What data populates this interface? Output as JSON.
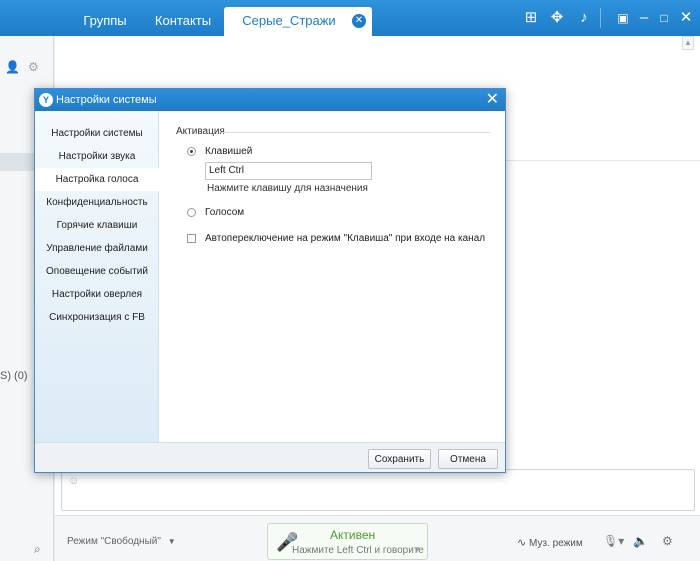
{
  "tabs": [
    {
      "label": "Группы"
    },
    {
      "label": "Контакты"
    },
    {
      "label": "Серые_Стражи",
      "active": true
    }
  ],
  "top_icons": [
    "gift-icon",
    "gamepad-icon",
    "bell-icon",
    "window-menu-icon",
    "minimize-icon",
    "maximize-icon",
    "close-icon"
  ],
  "left_panel": {
    "count_text": "S) (0)"
  },
  "dialog": {
    "title": "Настройки системы",
    "nav": [
      "Настройки системы",
      "Настройки звука",
      "Настройка голоса",
      "Конфиденциальность",
      "Горячие клавиши",
      "Управление файлами",
      "Оповещение событий",
      "Настройки оверлея",
      "Синхронизация с FB"
    ],
    "active_nav_index": 2,
    "group_label": "Активация",
    "option_key": "Клавишей",
    "key_value": "Left Ctrl",
    "key_hint": "Нажмите клавишу для назначения",
    "option_voice": "Голосом",
    "auto_switch": "Автопереключение на режим \"Клавиша\" при входе на канал",
    "save_label": "Сохранить",
    "cancel_label": "Отмена"
  },
  "bottom": {
    "mode": "Режим \"Свободный\"",
    "voice_status": "Активен",
    "voice_hint": "Нажмите Left Ctrl и говорите",
    "music_mode": "Муз. режим"
  },
  "colors": {
    "accent": "#1e7cc7",
    "voice_active": "#4c9a2a"
  }
}
